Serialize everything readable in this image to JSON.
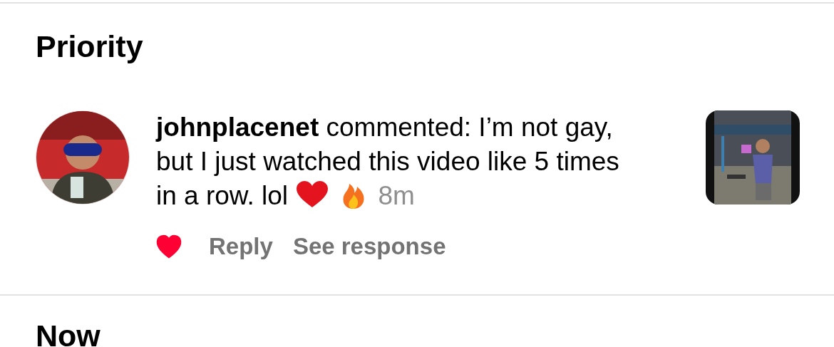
{
  "sections": [
    {
      "title": "Priority",
      "notifications": [
        {
          "username": "johnplacenet",
          "message": "commented: I’m not gay, but I just watched this video like 5 times in a row. lol",
          "time": "8m",
          "liked": true,
          "actions": [
            "Reply",
            "See response"
          ]
        }
      ]
    },
    {
      "title": "Now"
    }
  ]
}
